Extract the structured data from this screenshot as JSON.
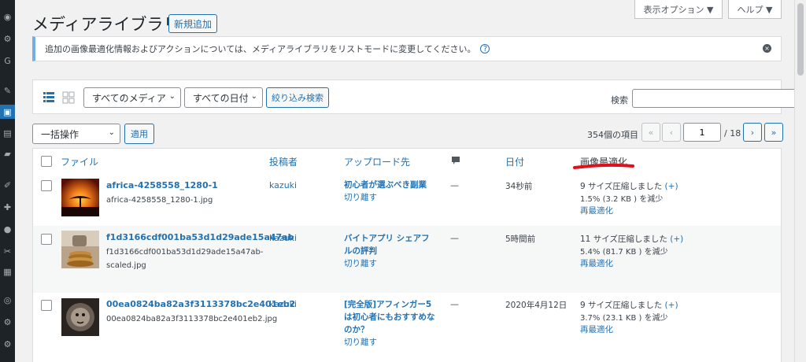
{
  "sidebar": {
    "icons": [
      "dashboard-icon",
      "gear-icon",
      "g-icon",
      "pin-icon",
      "media-icon",
      "pages-icon",
      "comments-icon",
      "appearance-icon",
      "plugins-icon",
      "users-icon",
      "tools-icon",
      "settings-icon",
      "circle-icon",
      "gear2-icon",
      "gear3-icon"
    ]
  },
  "screen_options": {
    "label": "表示オプション ▼",
    "help": "ヘルプ ▼"
  },
  "page": {
    "title": "メディアライブラリ",
    "add_new": "新規追加"
  },
  "notice": {
    "text": "追加の画像最適化情報およびアクションについては、メディアライブラリをリストモードに変更してください。",
    "help": "?",
    "dismiss": "×"
  },
  "filters": {
    "media_type": "すべてのメディア",
    "dates": "すべての日付",
    "filter_button": "絞り込み検索",
    "search_label": "検索",
    "search_value": ""
  },
  "bulk": {
    "action": "一括操作",
    "apply": "適用"
  },
  "pagination": {
    "items": "354個の項目",
    "first": "«",
    "prev": "‹",
    "current": "1",
    "total": "/ 18",
    "next": "›",
    "last": "»"
  },
  "columns": {
    "file": "ファイル",
    "author": "投稿者",
    "uploaded_to": "アップロード先",
    "comments_icon": "comment-icon",
    "date": "日付",
    "optimize": "画像最適化"
  },
  "rows": [
    {
      "title": "africa-4258558_1280-1",
      "file": "africa-4258558_1280-1.jpg",
      "author": "kazuki",
      "uploaded_to": "初心者が選ぶべき副業",
      "detach": "切り離す",
      "comments": "—",
      "date": "34秒前",
      "opt_line1": "9 サイズ圧縮しました",
      "opt_plus": "(+)",
      "opt_line2": "1.5% (3.2 KB ) を減少",
      "reoptimize": "再最適化"
    },
    {
      "title": "f1d3166cdf001ba53d1d29ade15a47ab",
      "file": "f1d3166cdf001ba53d1d29ade15a47ab-scaled.jpg",
      "author": "kazuki",
      "uploaded_to": "バイトアプリ シェアフルの評判",
      "detach": "切り離す",
      "comments": "—",
      "date": "5時間前",
      "opt_line1": "11 サイズ圧縮しました",
      "opt_plus": "(+)",
      "opt_line2": "5.4% (81.7 KB ) を減少",
      "reoptimize": "再最適化"
    },
    {
      "title": "00ea0824ba82a3f3113378bc2e401eb2",
      "file": "00ea0824ba82a3f3113378bc2e401eb2.jpg",
      "author": "kazuki",
      "uploaded_to": "[完全版]アフィンガー5は初心者にもおすすめなのか？",
      "detach": "切り離す",
      "comments": "—",
      "date": "2020年4月12日",
      "opt_line1": "9 サイズ圧縮しました",
      "opt_plus": "(+)",
      "opt_line2": "3.7% (23.1 KB ) を減少",
      "reoptimize": "再最適化"
    }
  ],
  "colors": {
    "accent": "#2271b1",
    "annotation": "#e0101c",
    "sidebar": "#1d2327"
  }
}
